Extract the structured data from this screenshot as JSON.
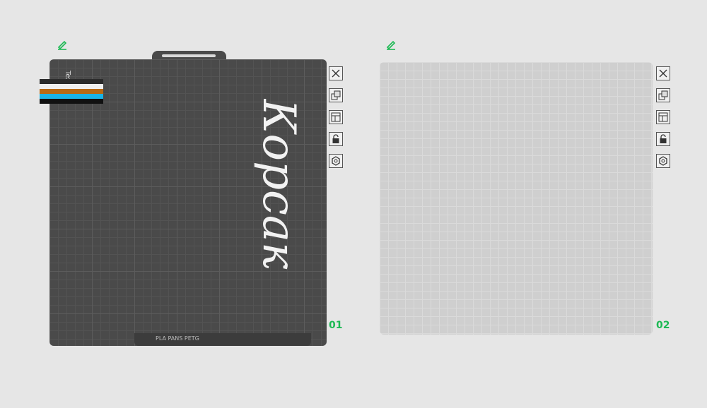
{
  "plates": [
    {
      "id": "plate-1",
      "number": "01",
      "side_label": "Text",
      "footer_filename": "PLA PANS PETG",
      "model_text": "Корсак",
      "filament_colors": [
        "#2b2b2b",
        "#f0f0f0",
        "#b86a14",
        "#1ab3e6",
        "#111111"
      ]
    },
    {
      "id": "plate-2",
      "number": "02"
    }
  ],
  "toolbar": {
    "icons": [
      "close-icon",
      "arrange-icon",
      "layout-icon",
      "lock-icon",
      "settings-icon"
    ]
  },
  "colors": {
    "accent": "#1db954",
    "bear_brown": "#b86a14",
    "text_blue": "#1ab3e6",
    "plate_dark": "#4a4a4a",
    "plate_light": "#cfcfcf"
  }
}
